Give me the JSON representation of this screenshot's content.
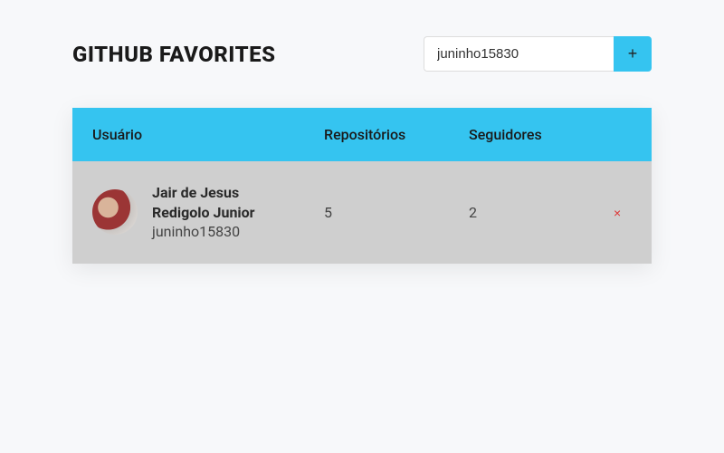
{
  "header": {
    "title": "GITHUB FAVORITES",
    "search_value": "juninho15830",
    "add_label": "+"
  },
  "table": {
    "columns": {
      "user": "Usuário",
      "repos": "Repositórios",
      "followers": "Seguidores"
    },
    "rows": [
      {
        "name": "Jair de Jesus Redigolo Junior",
        "login": "juninho15830",
        "repos": "5",
        "followers": "2",
        "remove_label": "×"
      }
    ]
  }
}
